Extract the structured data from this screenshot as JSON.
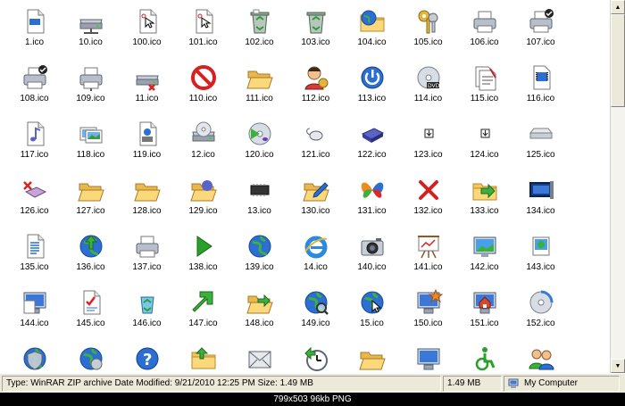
{
  "icons": [
    {
      "label": "1.ico",
      "icon": "blank-document-icon"
    },
    {
      "label": "10.ico",
      "icon": "network-drive-icon"
    },
    {
      "label": "100.ico",
      "icon": "cursor-document-icon"
    },
    {
      "label": "101.ico",
      "icon": "cursor-document-icon"
    },
    {
      "label": "102.ico",
      "icon": "recycle-bin-full-icon"
    },
    {
      "label": "103.ico",
      "icon": "recycle-bin-icon"
    },
    {
      "label": "104.ico",
      "icon": "network-folder-icon"
    },
    {
      "label": "105.ico",
      "icon": "keys-icon"
    },
    {
      "label": "106.ico",
      "icon": "printer-icon"
    },
    {
      "label": "107.ico",
      "icon": "default-printer-icon"
    },
    {
      "label": "108.ico",
      "icon": "default-printer-icon"
    },
    {
      "label": "109.ico",
      "icon": "network-printer-icon"
    },
    {
      "label": "11.ico",
      "icon": "disconnected-drive-icon"
    },
    {
      "label": "110.ico",
      "icon": "no-entry-icon"
    },
    {
      "label": "111.ico",
      "icon": "open-folder-icon"
    },
    {
      "label": "112.ico",
      "icon": "user-icon"
    },
    {
      "label": "113.ico",
      "icon": "power-icon"
    },
    {
      "label": "114.ico",
      "icon": "dvd-icon"
    },
    {
      "label": "115.ico",
      "icon": "documents-icon"
    },
    {
      "label": "116.ico",
      "icon": "media-file-icon"
    },
    {
      "label": "117.ico",
      "icon": "music-file-icon"
    },
    {
      "label": "118.ico",
      "icon": "photos-icon"
    },
    {
      "label": "119.ico",
      "icon": "video-file-icon"
    },
    {
      "label": "12.ico",
      "icon": "cd-drive-icon"
    },
    {
      "label": "120.ico",
      "icon": "music-cd-icon"
    },
    {
      "label": "121.ico",
      "icon": "mouse-icon"
    },
    {
      "label": "122.ico",
      "icon": "zip-drive-icon"
    },
    {
      "label": "123.ico",
      "icon": "small-arrow-icon"
    },
    {
      "label": "124.ico",
      "icon": "small-arrow-icon"
    },
    {
      "label": "125.ico",
      "icon": "hard-drive-icon"
    },
    {
      "label": "126.ico",
      "icon": "delete-drive-icon"
    },
    {
      "label": "127.ico",
      "icon": "open-folder-icon"
    },
    {
      "label": "128.ico",
      "icon": "open-folder-icon"
    },
    {
      "label": "129.ico",
      "icon": "music-folder-icon"
    },
    {
      "label": "13.ico",
      "icon": "chip-icon"
    },
    {
      "label": "130.ico",
      "icon": "edit-folder-icon"
    },
    {
      "label": "131.ico",
      "icon": "msn-butterfly-icon"
    },
    {
      "label": "132.ico",
      "icon": "red-x-icon"
    },
    {
      "label": "133.ico",
      "icon": "move-to-icon"
    },
    {
      "label": "134.ico",
      "icon": "desktop-icon"
    },
    {
      "label": "135.ico",
      "icon": "text-document-icon"
    },
    {
      "label": "136.ico",
      "icon": "globe-upload-icon"
    },
    {
      "label": "137.ico",
      "icon": "printer-icon"
    },
    {
      "label": "138.ico",
      "icon": "play-icon"
    },
    {
      "label": "139.ico",
      "icon": "globe-icon"
    },
    {
      "label": "14.ico",
      "icon": "internet-explorer-icon"
    },
    {
      "label": "140.ico",
      "icon": "camera-icon"
    },
    {
      "label": "141.ico",
      "icon": "projector-icon"
    },
    {
      "label": "142.ico",
      "icon": "desktop-background-icon"
    },
    {
      "label": "143.ico",
      "icon": "picture-icon"
    },
    {
      "label": "144.ico",
      "icon": "computer-document-icon"
    },
    {
      "label": "145.ico",
      "icon": "checklist-icon"
    },
    {
      "label": "146.ico",
      "icon": "recycle-icon"
    },
    {
      "label": "147.ico",
      "icon": "green-arrow-icon"
    },
    {
      "label": "148.ico",
      "icon": "folder-arrow-icon"
    },
    {
      "label": "149.ico",
      "icon": "globe-search-icon"
    },
    {
      "label": "15.ico",
      "icon": "globe-cursor-icon"
    },
    {
      "label": "150.ico",
      "icon": "network-star-icon"
    },
    {
      "label": "151.ico",
      "icon": "home-icon"
    },
    {
      "label": "152.ico",
      "icon": "cd-burn-icon"
    },
    {
      "label": "",
      "icon": "security-icon"
    },
    {
      "label": "",
      "icon": "globe-tools-icon"
    },
    {
      "label": "",
      "icon": "help-icon"
    },
    {
      "label": "",
      "icon": "folder-upload-icon"
    },
    {
      "label": "",
      "icon": "mail-icon"
    },
    {
      "label": "",
      "icon": "clock-arrow-icon"
    },
    {
      "label": "",
      "icon": "open-folder-icon"
    },
    {
      "label": "",
      "icon": "monitor-icon"
    },
    {
      "label": "",
      "icon": "accessibility-icon"
    },
    {
      "label": "",
      "icon": "users-icon"
    }
  ],
  "statusbar": {
    "type_text": "Type: WinRAR ZIP archive Date Modified: 9/21/2010 12:25 PM Size: 1.49 MB",
    "size_text": "1.49 MB",
    "location_text": "My Computer"
  },
  "footer": {
    "text": "799x503  96kb  PNG"
  },
  "colors": {
    "xp_chrome": "#ece9d8",
    "folder_yellow": "#f4c65a",
    "globe_blue": "#2a6fd1"
  }
}
